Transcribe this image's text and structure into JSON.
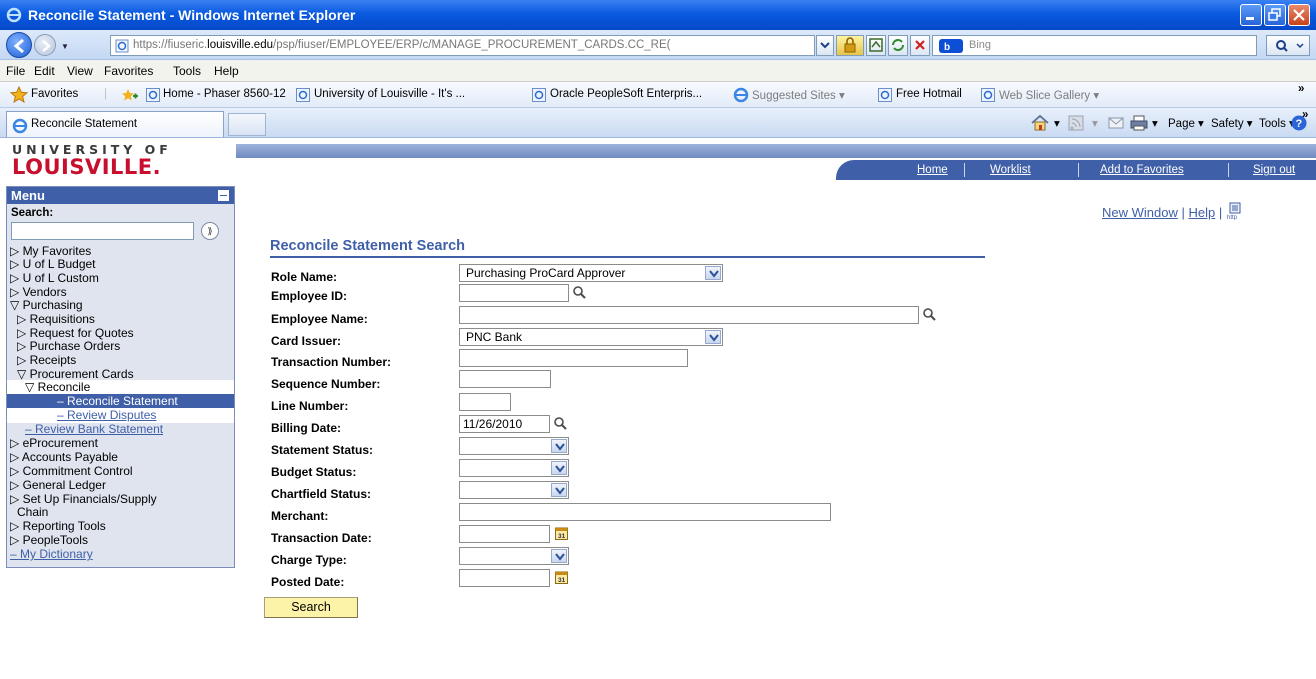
{
  "window": {
    "title": "Reconcile Statement - Windows Internet Explorer"
  },
  "address_bar": {
    "url_prefix": "https://fiuseric.",
    "url_domain": "louisville.edu",
    "url_path": "/psp/fiuser/EMPLOYEE/ERP/c/MANAGE_PROCUREMENT_CARDS.CC_RE(",
    "search_placeholder": "Bing"
  },
  "menubar": [
    "File",
    "Edit",
    "View",
    "Favorites",
    "Tools",
    "Help"
  ],
  "favorites_bar": {
    "favorites_label": "Favorites",
    "items": [
      "Home - Phaser 8560-12",
      "University of Louisville - It's ...",
      "Oracle PeopleSoft Enterpris...",
      "Suggested Sites ▾",
      "Free Hotmail",
      "Web Slice Gallery ▾"
    ]
  },
  "tabs": {
    "active": "Reconcile Statement",
    "commands": [
      "Page ▾",
      "Safety ▾",
      "Tools ▾"
    ]
  },
  "header": {
    "logo_line1": "UNIVERSITY OF",
    "logo_line2": "LOUISVILLE.",
    "nav": [
      "Home",
      "Worklist",
      "Add to Favorites",
      "Sign out"
    ]
  },
  "sidebar": {
    "title": "Menu",
    "search_label": "Search:",
    "items": [
      {
        "label": "▷ My Favorites"
      },
      {
        "label": "▷ U of L Budget"
      },
      {
        "label": "▷ U of L Custom"
      },
      {
        "label": "▷ Vendors"
      },
      {
        "label": "▽ Purchasing"
      },
      {
        "label": "▷ Requisitions"
      },
      {
        "label": "▷ Request for Quotes"
      },
      {
        "label": "▷ Purchase Orders"
      },
      {
        "label": "▷ Receipts"
      },
      {
        "label": "▽ Procurement Cards"
      },
      {
        "label": "▽ Reconcile"
      },
      {
        "label": "– Reconcile Statement"
      },
      {
        "label": "– Review Disputes"
      },
      {
        "label": "– Review Bank Statement"
      },
      {
        "label": "▷ eProcurement"
      },
      {
        "label": "▷ Accounts Payable"
      },
      {
        "label": "▷ Commitment Control"
      },
      {
        "label": "▷ General Ledger"
      },
      {
        "label": "▷ Set Up Financials/Supply"
      },
      {
        "label": "Chain"
      },
      {
        "label": "▷ Reporting Tools"
      },
      {
        "label": "▷ PeopleTools"
      },
      {
        "label": "– My Dictionary"
      }
    ]
  },
  "page_links": {
    "new_window": "New Window",
    "sep": "|",
    "help": "Help"
  },
  "form": {
    "title": "Reconcile Statement Search",
    "role_name": {
      "label": "Role Name:",
      "value": "Purchasing ProCard Approver"
    },
    "employee_id": {
      "label": "Employee ID:",
      "value": ""
    },
    "employee_name": {
      "label": "Employee Name:",
      "value": ""
    },
    "card_issuer": {
      "label": "Card Issuer:",
      "value": "PNC Bank"
    },
    "transaction_number": {
      "label": "Transaction Number:",
      "value": ""
    },
    "sequence_number": {
      "label": "Sequence Number:",
      "value": ""
    },
    "line_number": {
      "label": "Line Number:",
      "value": ""
    },
    "billing_date": {
      "label": "Billing Date:",
      "value": "11/26/2010"
    },
    "statement_status": {
      "label": "Statement Status:",
      "value": ""
    },
    "budget_status": {
      "label": "Budget Status:",
      "value": ""
    },
    "chartfield_status": {
      "label": "Chartfield Status:",
      "value": ""
    },
    "merchant": {
      "label": "Merchant:",
      "value": ""
    },
    "transaction_date": {
      "label": "Transaction Date:",
      "value": ""
    },
    "charge_type": {
      "label": "Charge Type:",
      "value": ""
    },
    "posted_date": {
      "label": "Posted Date:",
      "value": ""
    },
    "search_button": "Search"
  },
  "colors": {
    "peoplesoft_blue": "#3f5fa8",
    "louisville_red": "#c8102e",
    "search_button": "#fcf3a8"
  }
}
